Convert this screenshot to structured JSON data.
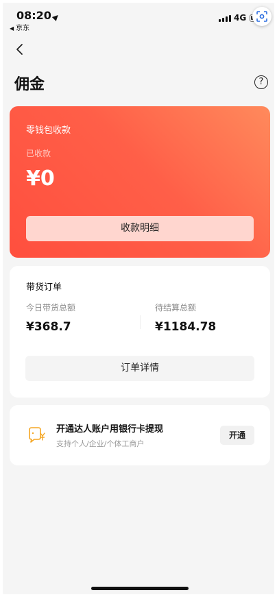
{
  "status_bar": {
    "time": "08:20",
    "back_app": "京东",
    "network": "4G"
  },
  "header": {
    "title": "佣金"
  },
  "wallet": {
    "title": "零钱包收款",
    "received_label": "已收款",
    "received_amount": "¥0",
    "detail_button": "收款明细"
  },
  "orders": {
    "title": "带货订单",
    "today_label": "今日带货总额",
    "today_value": "¥368.7",
    "pending_label": "待结算总额",
    "pending_value": "¥1184.78",
    "detail_button": "订单详情"
  },
  "bank": {
    "title": "开通达人账户用银行卡提现",
    "subtitle": "支持个人/企业/个体工商户",
    "open_button": "开通"
  },
  "colors": {
    "accent_start": "#ff8a5c",
    "accent_end": "#ff4f3e",
    "icon_orange": "#f5a623"
  }
}
